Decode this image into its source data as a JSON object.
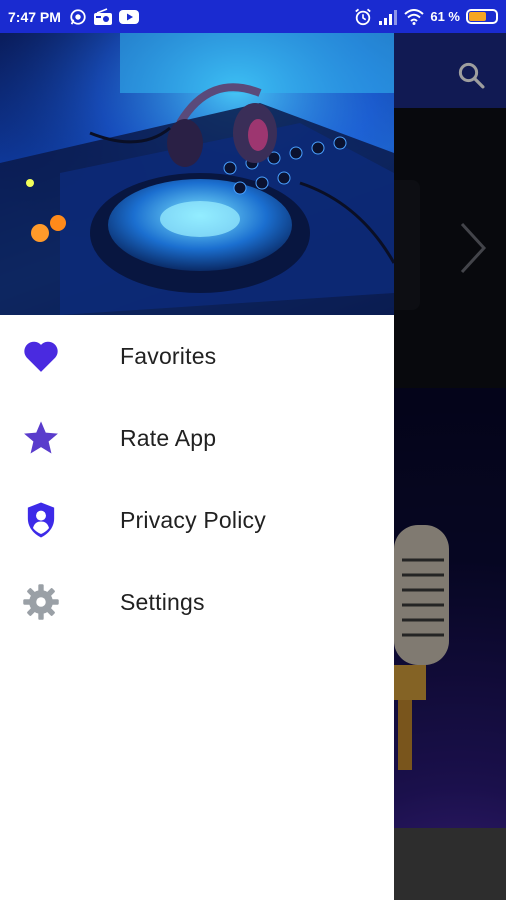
{
  "status_bar": {
    "time": "7:47 PM",
    "left_icons": [
      "whatsapp-icon",
      "radio-icon",
      "youtube-icon"
    ],
    "right_icons": [
      "alarm-icon",
      "signal-icon",
      "wifi-icon"
    ],
    "battery_text": "61 %",
    "battery_level": 0.61,
    "battery_color": "#f5a623",
    "background": "#1a2bd0"
  },
  "app": {
    "toolbar_color": "#1c2a86",
    "search_icon": "search-icon",
    "next_icon": "chevron-right-icon"
  },
  "drawer": {
    "header_image": "dj-mixer-headphones",
    "items": [
      {
        "label": "Favorites",
        "icon": "heart-icon",
        "icon_color": "#4a2ae0"
      },
      {
        "label": "Rate App",
        "icon": "star-icon",
        "icon_color": "#5a3ccc"
      },
      {
        "label": "Privacy Policy",
        "icon": "shield-user-icon",
        "icon_color": "#3d2ae8"
      },
      {
        "label": "Settings",
        "icon": "gear-icon",
        "icon_color": "#9aa0a6"
      }
    ]
  }
}
